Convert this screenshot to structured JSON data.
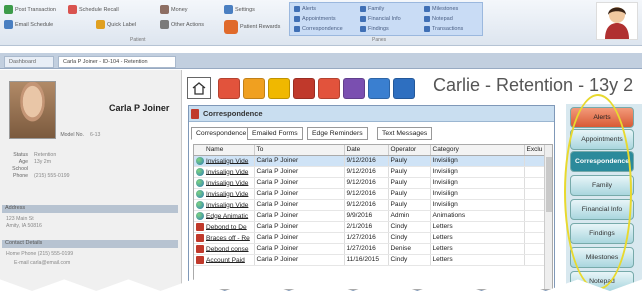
{
  "ribbon": {
    "buttons": [
      {
        "label": "Post Transaction",
        "icon": "dollar-icon",
        "color": "#3d9b4a"
      },
      {
        "label": "Schedule Recall",
        "icon": "calendar-icon",
        "color": "#d9534f"
      },
      {
        "label": "Money",
        "icon": "money-icon",
        "color": "#8d6e63"
      },
      {
        "label": "Settings",
        "icon": "gear-icon",
        "color": "#4a7fc1"
      },
      {
        "label": "Email Schedule",
        "icon": "email-icon",
        "color": "#4a7fc1"
      },
      {
        "label": "Quick Label",
        "icon": "label-icon",
        "color": "#e0a020"
      },
      {
        "label": "Other Actions",
        "icon": "actions-icon",
        "color": "#7a7a7a"
      },
      {
        "label": "Patient Rewards",
        "icon": "rewards-icon",
        "color": "#e06a2b"
      }
    ],
    "group_patient": "Patient",
    "group_panes": "Panes",
    "panes": [
      {
        "label": "Alerts"
      },
      {
        "label": "Family"
      },
      {
        "label": "Milestones"
      },
      {
        "label": "Appointments"
      },
      {
        "label": "Financial Info"
      },
      {
        "label": "Notepad"
      },
      {
        "label": "Correspondence"
      },
      {
        "label": "Findings"
      },
      {
        "label": "Transactions"
      }
    ]
  },
  "doc_tabs": [
    {
      "label": "Dashboard"
    },
    {
      "label": "Carla P Joiner - ID-104 - Retention"
    }
  ],
  "patient": {
    "name": "Carla P Joiner",
    "fields": [
      {
        "k": "Status",
        "v": "Retention"
      },
      {
        "k": "Age",
        "v": "13y 2m"
      },
      {
        "k": "School",
        "v": ""
      },
      {
        "k": "Phone",
        "v": "(215) 555-0199"
      },
      {
        "k": "Model No.",
        "v": "6-13"
      }
    ],
    "sections": [
      "Address",
      "Contact Details"
    ],
    "address": "123 Main St",
    "city": "Amity, IA 50816",
    "contact_home": "Home Phone (215) 555-0199",
    "contact_email": "E-mail carla@email.com"
  },
  "banner": "Carlie - Retention - 13y 2",
  "colored_buttons": [
    "#e2533c",
    "#f0a020",
    "#f0b800",
    "#c0392b",
    "#e2533c",
    "#7a4fb0",
    "#3a7fd0",
    "#2e6fc0"
  ],
  "correspondence": {
    "title": "Correspondence",
    "subtabs": [
      "Correspondence",
      "Emailed Forms",
      "Edge Reminders",
      "Text Messages"
    ],
    "columns": [
      "Name",
      "To",
      "Date",
      "Operator",
      "Category",
      "Exclu"
    ],
    "rows": [
      {
        "icon": "globe",
        "name": "Invisalign Vide",
        "to": "Carla P Joiner",
        "date": "9/12/2016",
        "op": "Pauly",
        "cat": "Invisilign"
      },
      {
        "icon": "globe",
        "name": "Invisalign Vide",
        "to": "Carla P Joiner",
        "date": "9/12/2016",
        "op": "Pauly",
        "cat": "Invisilign"
      },
      {
        "icon": "globe",
        "name": "Invisalign Vide",
        "to": "Carla P Joiner",
        "date": "9/12/2016",
        "op": "Pauly",
        "cat": "Invisilign"
      },
      {
        "icon": "globe",
        "name": "Invisalign Vide",
        "to": "Carla P Joiner",
        "date": "9/12/2016",
        "op": "Pauly",
        "cat": "Invisilign"
      },
      {
        "icon": "globe",
        "name": "Invisalign Vide",
        "to": "Carla P Joiner",
        "date": "9/12/2016",
        "op": "Pauly",
        "cat": "Invisilign"
      },
      {
        "icon": "globe",
        "name": "Edge Animatic",
        "to": "Carla P Joiner",
        "date": "9/9/2016",
        "op": "Admin",
        "cat": "Animations"
      },
      {
        "icon": "pdf",
        "name": "Debond to De",
        "to": "Carla P Joiner",
        "date": "2/1/2016",
        "op": "Cindy",
        "cat": "Letters"
      },
      {
        "icon": "pdf",
        "name": "Braces off - Re",
        "to": "Carla P Joiner",
        "date": "1/27/2016",
        "op": "Cindy",
        "cat": "Letters"
      },
      {
        "icon": "pdf",
        "name": "Debond conse",
        "to": "Carla P Joiner",
        "date": "1/27/2016",
        "op": "Denise",
        "cat": "Letters"
      },
      {
        "icon": "pdf",
        "name": "Account Paid",
        "to": "Carla P Joiner",
        "date": "11/16/2015",
        "op": "Cindy",
        "cat": "Letters"
      }
    ]
  },
  "nav": {
    "items": [
      "Alerts",
      "Appointments",
      "Correspondence",
      "Family",
      "Financial Info",
      "Findings",
      "Milestones",
      "Notepad"
    ]
  }
}
